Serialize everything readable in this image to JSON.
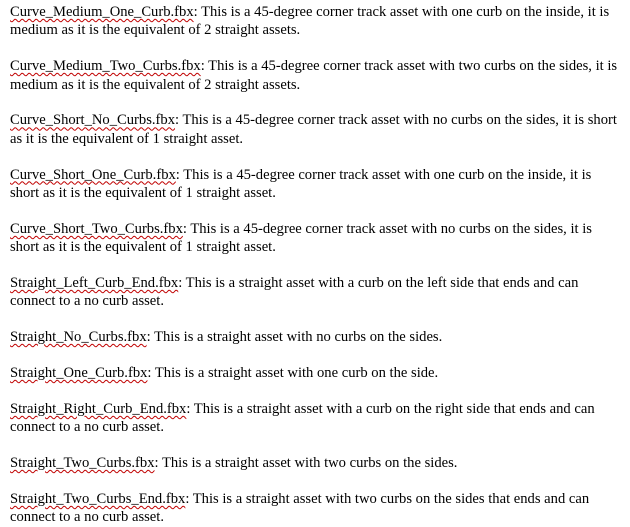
{
  "entries": [
    {
      "file": "Curve_Medium_One_Curb.fbx",
      "desc": ": This is a 45-degree corner track asset with one curb on the inside, it is medium as it is the equivalent of 2 straight assets."
    },
    {
      "file": "Curve_Medium_Two_Curbs.fbx",
      "desc": ": This is a 45-degree corner track asset with two curbs on the sides, it is medium as it is the equivalent of 2 straight assets."
    },
    {
      "file": "Curve_Short_No_Curbs.fbx",
      "desc": ": This is a 45-degree corner track asset with no curbs on the sides, it is short as it is the equivalent of 1 straight asset."
    },
    {
      "file": "Curve_Short_One_Curb.fbx",
      "desc": ": This is a 45-degree corner track asset with one curb on the inside, it is short as it is the equivalent of 1 straight asset."
    },
    {
      "file": "Curve_Short_Two_Curbs.fbx",
      "desc": ": This is a 45-degree corner track asset with no curbs on the sides, it is short as it is the equivalent of 1 straight asset."
    },
    {
      "file": "Straight_Left_Curb_End.fbx",
      "desc": ": This is a straight asset with a curb on the left side that ends and can connect to a no curb asset."
    },
    {
      "file": "Straight_No_Curbs.fbx",
      "desc": ": This is a straight asset with no curbs on the sides."
    },
    {
      "file": "Straight_One_Curb.fbx",
      "desc": ": This is a straight asset with one curb on the side."
    },
    {
      "file": "Straight_Right_Curb_End.fbx",
      "desc": ": This is a straight asset with a curb on the right side that ends and can connect to a no curb asset."
    },
    {
      "file": "Straight_Two_Curbs.fbx",
      "desc": ": This is a straight asset with two curbs on the sides."
    },
    {
      "file": "Straight_Two_Curbs_End.fbx",
      "desc": ": This is a straight asset with two curbs on the sides that ends and can connect to a no curb asset."
    }
  ],
  "colors": {
    "text": "#000000",
    "spellcheck_underline": "#c00000",
    "background": "#ffffff"
  }
}
